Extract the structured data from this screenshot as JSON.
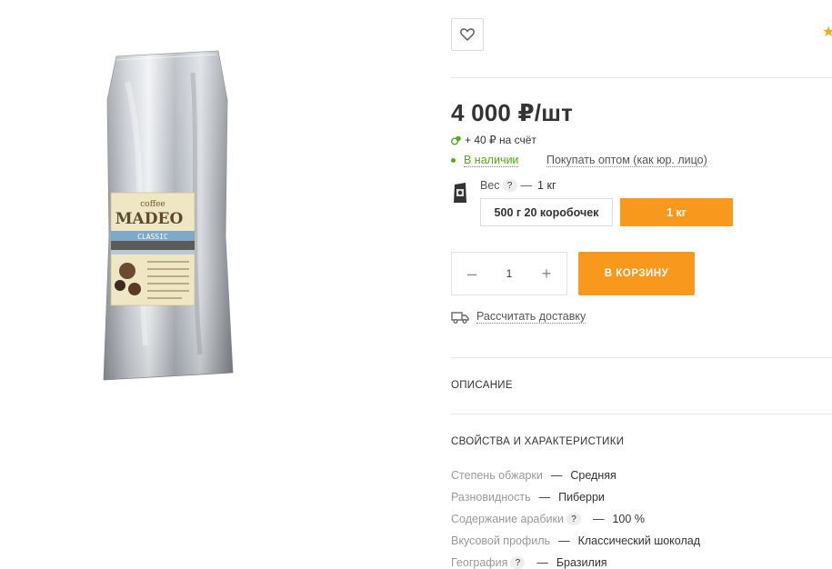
{
  "product": {
    "image_alt": "Пакет кофе Coffee Madeo Classic",
    "package_text": {
      "brand_top": "coffee",
      "brand": "MADEO",
      "variant": "CLASSIC"
    }
  },
  "favorite": {
    "icon": "heart-icon"
  },
  "rating": {
    "icon": "star-icon"
  },
  "price": {
    "value": "4 000 ₽/шт"
  },
  "bonus": {
    "text": "+ 40 ₽ на счёт",
    "icon": "bonus-coins-icon"
  },
  "stock": {
    "status": "В наличии",
    "wholesale_link": "Покупать оптом (как юр. лицо)"
  },
  "weight": {
    "label": "Вес",
    "help": "?",
    "dash": "—",
    "selected": "1 кг",
    "options": [
      {
        "label": "500 г 20 коробочек",
        "active": false
      },
      {
        "label": "1 кг",
        "active": true
      }
    ]
  },
  "quantity": {
    "minus": "–",
    "value": "1",
    "plus": "+"
  },
  "cart": {
    "label": "В КОРЗИНУ"
  },
  "delivery": {
    "label": "Рассчитать доставку",
    "icon": "truck-icon"
  },
  "sections": {
    "description": "ОПИСАНИЕ",
    "properties": "СВОЙСТВА И ХАРАКТЕРИСТИКИ"
  },
  "properties": [
    {
      "key": "Степень обжарки",
      "help": "",
      "value": "Средняя"
    },
    {
      "key": "Разновидность",
      "help": "",
      "value": "Пиберри"
    },
    {
      "key": "Содержание арабики",
      "help": "?",
      "value": "100 %"
    },
    {
      "key": "Вкусовой профиль",
      "help": "",
      "value": "Классический шоколад"
    },
    {
      "key": "География",
      "help": "?",
      "value": "Бразилия"
    }
  ],
  "colors": {
    "accent": "#f8991d",
    "stock": "#58a81f",
    "star": "#f4a90f"
  }
}
